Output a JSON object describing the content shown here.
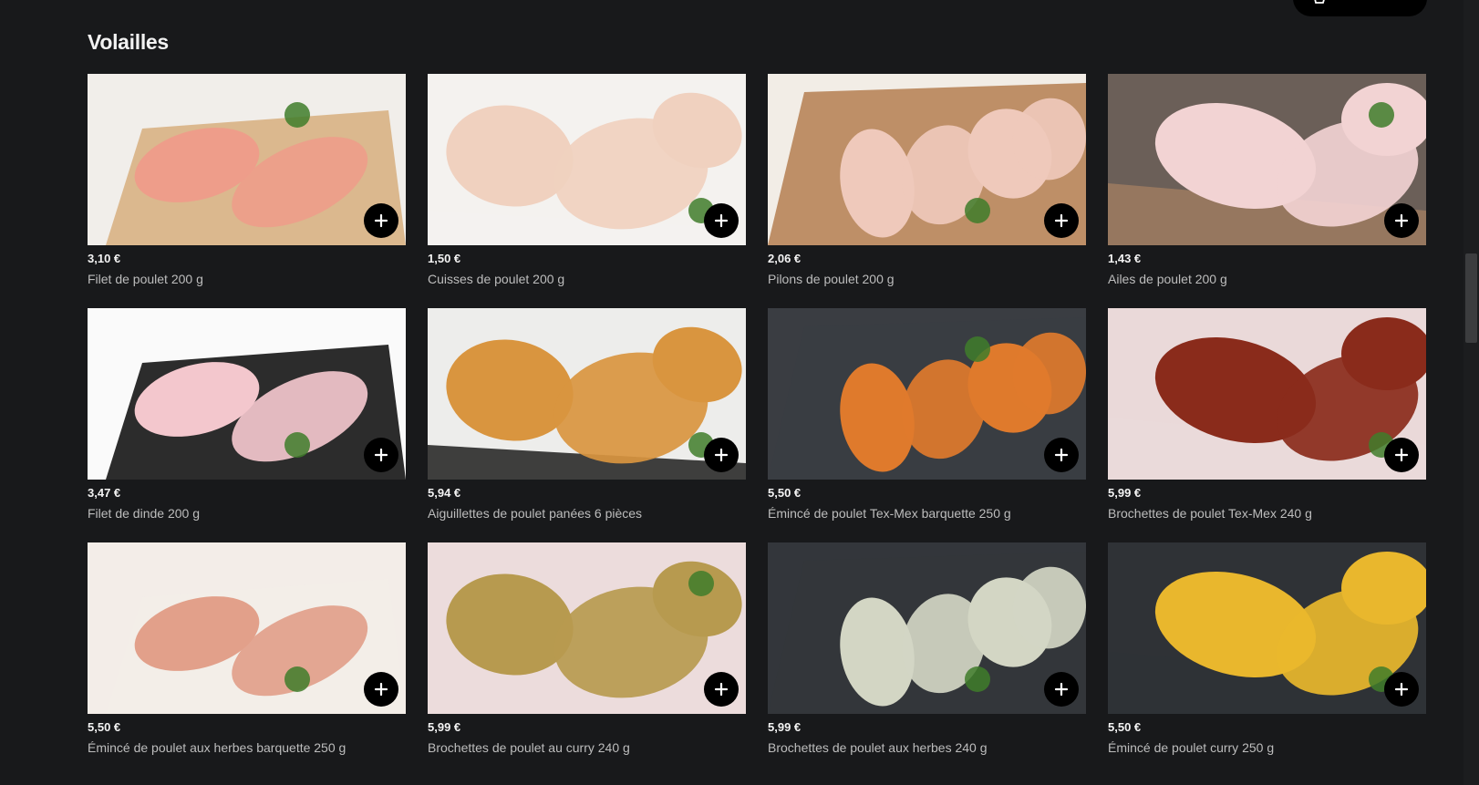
{
  "section": {
    "title": "Volailles"
  },
  "products": [
    {
      "price": "3,10 €",
      "name": "Filet de poulet 200 g",
      "icon": "chicken-breast-image",
      "bg": "#f1eeea",
      "accent": "#ee9d8a",
      "base": "#d8b184"
    },
    {
      "price": "1,50 €",
      "name": "Cuisses de poulet 200 g",
      "icon": "chicken-thigh-image",
      "bg": "#f4f2ef",
      "accent": "#f0d1bf",
      "base": "#f4f2ef"
    },
    {
      "price": "2,06 €",
      "name": "Pilons de poulet 200 g",
      "icon": "drumstick-image",
      "bg": "#f2ede6",
      "accent": "#efc9bb",
      "base": "#b88459"
    },
    {
      "price": "1,43 €",
      "name": "Ailes de poulet 200 g",
      "icon": "chicken-wing-image",
      "bg": "#6b5f58",
      "accent": "#f2d3d3",
      "base": "#9b7a60"
    },
    {
      "price": "3,47 €",
      "name": "Filet de dinde 200 g",
      "icon": "turkey-fillet-image",
      "bg": "#fafafa",
      "accent": "#f3c7cd",
      "base": "#151515"
    },
    {
      "price": "5,94 €",
      "name": "Aiguillettes de poulet panées 6 pièces",
      "icon": "breaded-chicken-image",
      "bg": "#ededeb",
      "accent": "#d9953f",
      "base": "#2a2a2a"
    },
    {
      "price": "5,50 €",
      "name": "Émincé de poulet Tex-Mex barquette 250 g",
      "icon": "tex-mex-strips-image",
      "bg": "#3a3d42",
      "accent": "#df7a2c",
      "base": "#3a3d42"
    },
    {
      "price": "5,99 €",
      "name": "Brochettes de poulet Tex-Mex 240 g",
      "icon": "tex-mex-skewer-image",
      "bg": "#ead9d9",
      "accent": "#8a2b1b",
      "base": "#ead9d9"
    },
    {
      "price": "5,50 €",
      "name": "Émincé de poulet aux herbes barquette 250 g",
      "icon": "herb-strips-image",
      "bg": "#f3ede8",
      "accent": "#e2a08a",
      "base": "#f3ede8"
    },
    {
      "price": "5,99 €",
      "name": "Brochettes de poulet au curry 240 g",
      "icon": "curry-skewer-image",
      "bg": "#ecdcdc",
      "accent": "#b79a4f",
      "base": "#ecdcdc"
    },
    {
      "price": "5,99 €",
      "name": "Brochettes de poulet aux herbes 240 g",
      "icon": "herb-skewer-image",
      "bg": "#33363b",
      "accent": "#d3d6c4",
      "base": "#33363b"
    },
    {
      "price": "5,50 €",
      "name": "Émincé de poulet curry 250 g",
      "icon": "curry-strips-image",
      "bg": "#2f3236",
      "accent": "#e9b72d",
      "base": "#2f3236"
    }
  ],
  "colors": {
    "background": "#18191b",
    "add_button": "#000000",
    "price_text": "#f4f4f4",
    "name_text": "#bdbdbd"
  },
  "icons": {
    "add": "plus-icon",
    "cart": "cart-icon"
  }
}
